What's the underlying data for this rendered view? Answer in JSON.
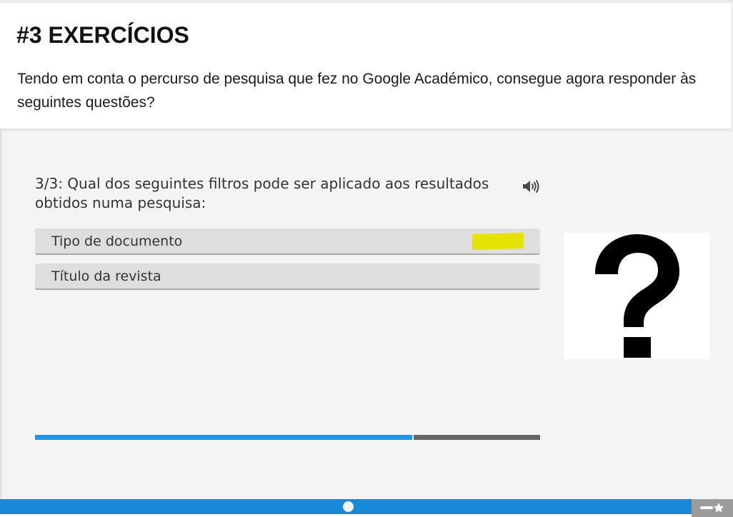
{
  "header": {
    "title": "#3 EXERCÍCIOS",
    "intro": "Tendo em conta o percurso de pesquisa que fez no Google Académico, consegue agora responder às seguintes questões?"
  },
  "quiz": {
    "question": "3/3: Qual dos seguintes filtros pode ser aplicado aos resultados obtidos numa pesquisa:",
    "audio_icon": "speaker-icon",
    "options": [
      {
        "label": "Tipo de documento",
        "highlighted": true
      },
      {
        "label": "Título da revista",
        "highlighted": false
      }
    ],
    "image_icon": "question-mark-icon",
    "progress_fraction": 0.75
  },
  "colors": {
    "accent": "#1d97e6",
    "footer": "#1889d9",
    "highlight": "#e4e400",
    "option_bg": "#dedede",
    "panel_bg": "#f4f4f4"
  },
  "footer": {
    "right_icon": "menu-star-icon"
  }
}
